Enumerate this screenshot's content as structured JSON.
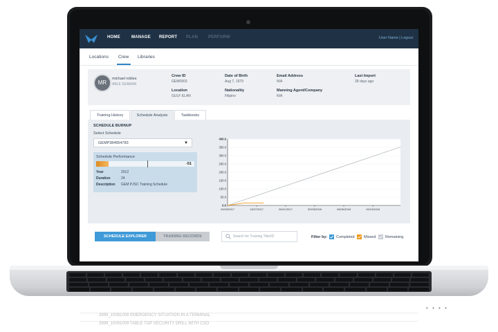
{
  "nav": {
    "items": [
      {
        "label": "HOME",
        "dim": false
      },
      {
        "label": "MANAGE",
        "dim": false
      },
      {
        "label": "REPORT",
        "dim": false
      },
      {
        "label": "PLAN",
        "dim": true
      },
      {
        "label": "PERFORM",
        "dim": true
      }
    ],
    "user": "User Name | Logout"
  },
  "subnav": {
    "items": [
      "Locations",
      "Crew",
      "Libraries"
    ],
    "active": "Crew"
  },
  "profile": {
    "initials": "MR",
    "name": "michael robles",
    "rank": "ABLE SEAMAN",
    "crew_id_label": "Crew ID",
    "crew_id": "GEM0903",
    "dob_label": "Date of Birth",
    "dob": "Aug 7, 1979",
    "email_label": "Email Address",
    "email": "N/A",
    "last_import_label": "Last Import",
    "last_import": "28 days ago",
    "location_label": "Location",
    "location": "GULF ELAN",
    "nationality_label": "Nationality",
    "nationality": "Filipino",
    "agent_label": "Manning Agent/Company",
    "agent": "N/A"
  },
  "tabs": [
    "Training History",
    "Schedule Analysis",
    "Taskbooks"
  ],
  "active_tab": "Schedule Analysis",
  "burnup": {
    "title": "SCHEDULE BURNUP",
    "select_label": "Select Schedule",
    "select_value": "GEMP384954783",
    "perf_title": "Schedule Performance",
    "perf_value": "-51",
    "year_label": "Year",
    "year": "2012",
    "duration_label": "Duration",
    "duration": "24",
    "description_label": "Description",
    "description": "GEM PJSC Training Schedule"
  },
  "chart_data": {
    "type": "line",
    "x_tick_labels": [
      "20/03/2017",
      "13/07/2017",
      "06/11/2017",
      "02/03/2018",
      "26/06/2018",
      "19/10/2018"
    ],
    "y_tick_labels": [
      "0.0",
      "50.0",
      "100.0",
      "150.0",
      "200.0",
      "250.0",
      "300.0",
      "350.0",
      "400.0"
    ],
    "ylim": [
      0,
      400
    ],
    "grid": true,
    "series": [
      {
        "color": "#9aa1a8",
        "x": [
          0,
          1.0
        ],
        "y": [
          0,
          352
        ]
      },
      {
        "color": "#f09a1d",
        "x": [
          0,
          0.1,
          0.21
        ],
        "y": [
          0,
          15,
          15
        ]
      }
    ]
  },
  "controls": {
    "btn_explorer": "SCHEDULE EXPLORER",
    "btn_records": "TRAINING RECORDS",
    "search_placeholder": "Search for Training Title/ID",
    "filter_label": "Filter by:",
    "completed": "Completed",
    "missed": "Missed",
    "remaining": "Remaining",
    "colors": {
      "completed": "#3f9ad8",
      "missed": "#f09a1d",
      "remaining": "#c7ccd2"
    }
  },
  "reflection_rows": [
    {
      "code": "3999_1008",
      "title": "1008 EMERGENCY SITUATION IN A TERMINAL"
    },
    {
      "code": "3999_1009",
      "title": "1009 TABLE TOP SECURITY DRILL WITH CSO"
    }
  ]
}
